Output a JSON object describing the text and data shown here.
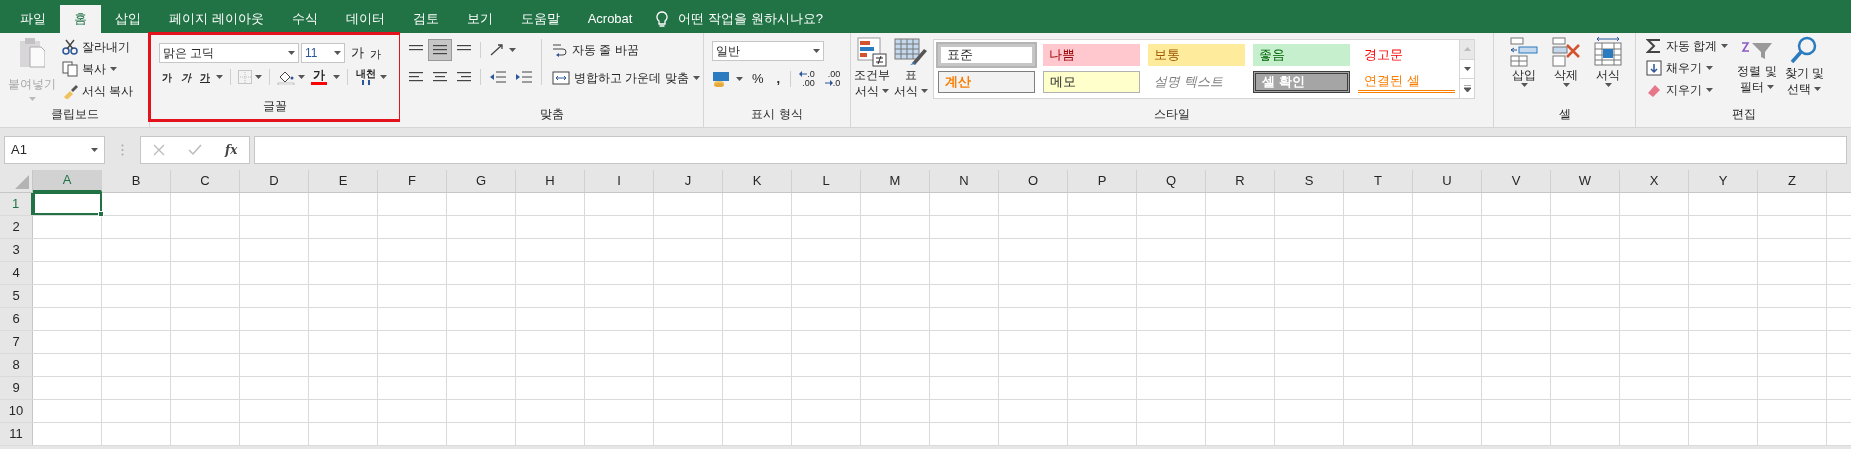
{
  "tabs": [
    {
      "label": "파일",
      "selected": false
    },
    {
      "label": "홈",
      "selected": true
    },
    {
      "label": "삽입",
      "selected": false
    },
    {
      "label": "페이지 레이아웃",
      "selected": false
    },
    {
      "label": "수식",
      "selected": false
    },
    {
      "label": "데이터",
      "selected": false
    },
    {
      "label": "검토",
      "selected": false
    },
    {
      "label": "보기",
      "selected": false
    },
    {
      "label": "도움말",
      "selected": false
    },
    {
      "label": "Acrobat",
      "selected": false
    }
  ],
  "tell_me": "어떤 작업을 원하시나요?",
  "clipboard": {
    "paste": "붙여넣기",
    "cut": "잘라내기",
    "copy": "복사",
    "format_painter": "서식 복사",
    "group": "클립보드"
  },
  "font": {
    "highlighted": true,
    "font_name": "맑은 고딕",
    "font_size": "11",
    "grow": "가",
    "shrink": "가",
    "bold": "가",
    "italic": "가",
    "underline": "가",
    "font_color": "가",
    "phonetic": "내천",
    "group": "글꼴"
  },
  "alignment": {
    "wrap_text": "자동 줄 바꿈",
    "merge": "병합하고 가운데 맞춤",
    "group": "맞춤"
  },
  "number": {
    "format": "일반",
    "percent": "%",
    "comma": ",",
    "increase_decimal": [
      ".0",
      ".00"
    ],
    "decrease_decimal": [
      ".00",
      ".0"
    ],
    "group": "표시 형식"
  },
  "styles": {
    "conditional": [
      "조건부",
      "서식"
    ],
    "table": [
      "표",
      "서식"
    ],
    "cells": [
      {
        "label": "표준",
        "kind": "normal",
        "selected": true
      },
      {
        "label": "나쁨",
        "kind": "bad",
        "selected": false
      },
      {
        "label": "보통",
        "kind": "neutral",
        "selected": false
      },
      {
        "label": "좋음",
        "kind": "good",
        "selected": false
      },
      {
        "label": "경고문",
        "kind": "warning",
        "selected": false
      },
      {
        "label": "계산",
        "kind": "calculation",
        "selected": false
      },
      {
        "label": "메모",
        "kind": "note",
        "selected": false
      },
      {
        "label": "설명 텍스트",
        "kind": "explanatory",
        "selected": false
      },
      {
        "label": "셀 확인",
        "kind": "check",
        "selected": false
      },
      {
        "label": "연결된 셀",
        "kind": "linked",
        "selected": false
      }
    ],
    "group": "스타일"
  },
  "cells": {
    "insert": "삽입",
    "delete": "삭제",
    "format": "서식",
    "group": "셀"
  },
  "editing": {
    "autosum": "자동 합계",
    "fill": "채우기",
    "clear": "지우기",
    "sort": [
      "정렬 및",
      "필터"
    ],
    "find": [
      "찾기 및",
      "선택"
    ],
    "group": "편집"
  },
  "formula_bar": {
    "name_box": "A1",
    "function_symbol": "fx"
  },
  "grid": {
    "columns": [
      {
        "label": "A",
        "selected": true
      },
      {
        "label": "B",
        "selected": false
      },
      {
        "label": "C",
        "selected": false
      },
      {
        "label": "D",
        "selected": false
      },
      {
        "label": "E",
        "selected": false
      },
      {
        "label": "F",
        "selected": false
      },
      {
        "label": "G",
        "selected": false
      },
      {
        "label": "H",
        "selected": false
      },
      {
        "label": "I",
        "selected": false
      },
      {
        "label": "J",
        "selected": false
      },
      {
        "label": "K",
        "selected": false
      },
      {
        "label": "L",
        "selected": false
      },
      {
        "label": "M",
        "selected": false
      },
      {
        "label": "N",
        "selected": false
      },
      {
        "label": "O",
        "selected": false
      },
      {
        "label": "P",
        "selected": false
      },
      {
        "label": "Q",
        "selected": false
      },
      {
        "label": "R",
        "selected": false
      },
      {
        "label": "S",
        "selected": false
      },
      {
        "label": "T",
        "selected": false
      },
      {
        "label": "U",
        "selected": false
      },
      {
        "label": "V",
        "selected": false
      },
      {
        "label": "W",
        "selected": false
      },
      {
        "label": "X",
        "selected": false
      },
      {
        "label": "Y",
        "selected": false
      },
      {
        "label": "Z",
        "selected": false
      }
    ],
    "rows": [
      {
        "label": "1",
        "selected": true
      },
      {
        "label": "2",
        "selected": false
      },
      {
        "label": "3",
        "selected": false
      },
      {
        "label": "4",
        "selected": false
      },
      {
        "label": "5",
        "selected": false
      },
      {
        "label": "6",
        "selected": false
      },
      {
        "label": "7",
        "selected": false
      },
      {
        "label": "8",
        "selected": false
      },
      {
        "label": "9",
        "selected": false
      },
      {
        "label": "10",
        "selected": false
      },
      {
        "label": "11",
        "selected": false
      }
    ]
  }
}
